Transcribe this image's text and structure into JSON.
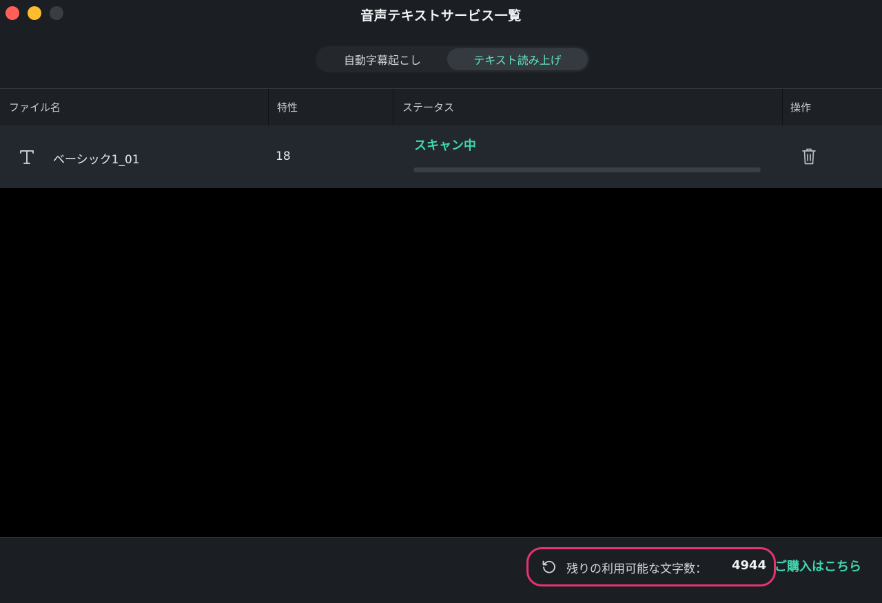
{
  "window": {
    "title": "音声テキストサービス一覧"
  },
  "tabs": [
    {
      "label": "自動字幕起こし",
      "active": false
    },
    {
      "label": "テキスト読み上げ",
      "active": true
    }
  ],
  "table": {
    "columns": [
      "ファイル名",
      "特性",
      "ステータス",
      "操作"
    ],
    "rows": [
      {
        "icon": "text-type-icon",
        "file_name": "ベーシック1_01",
        "property": "18",
        "status": "スキャン中",
        "progress": 0,
        "action_icon": "trash-icon"
      }
    ]
  },
  "footer": {
    "refresh_icon": "refresh-icon",
    "remaining_label": "残りの利用可能な文字数：",
    "remaining_count": "4944",
    "purchase_link": "ご購入はこちら"
  },
  "colors": {
    "accent": "#3fd7b1",
    "highlight_border": "#e8336f",
    "window_bg": "#1b1e22",
    "row_bg": "#23272e",
    "traffic_close": "#fe5f57",
    "traffic_min": "#febc2e",
    "traffic_max": "#3b3d40"
  }
}
